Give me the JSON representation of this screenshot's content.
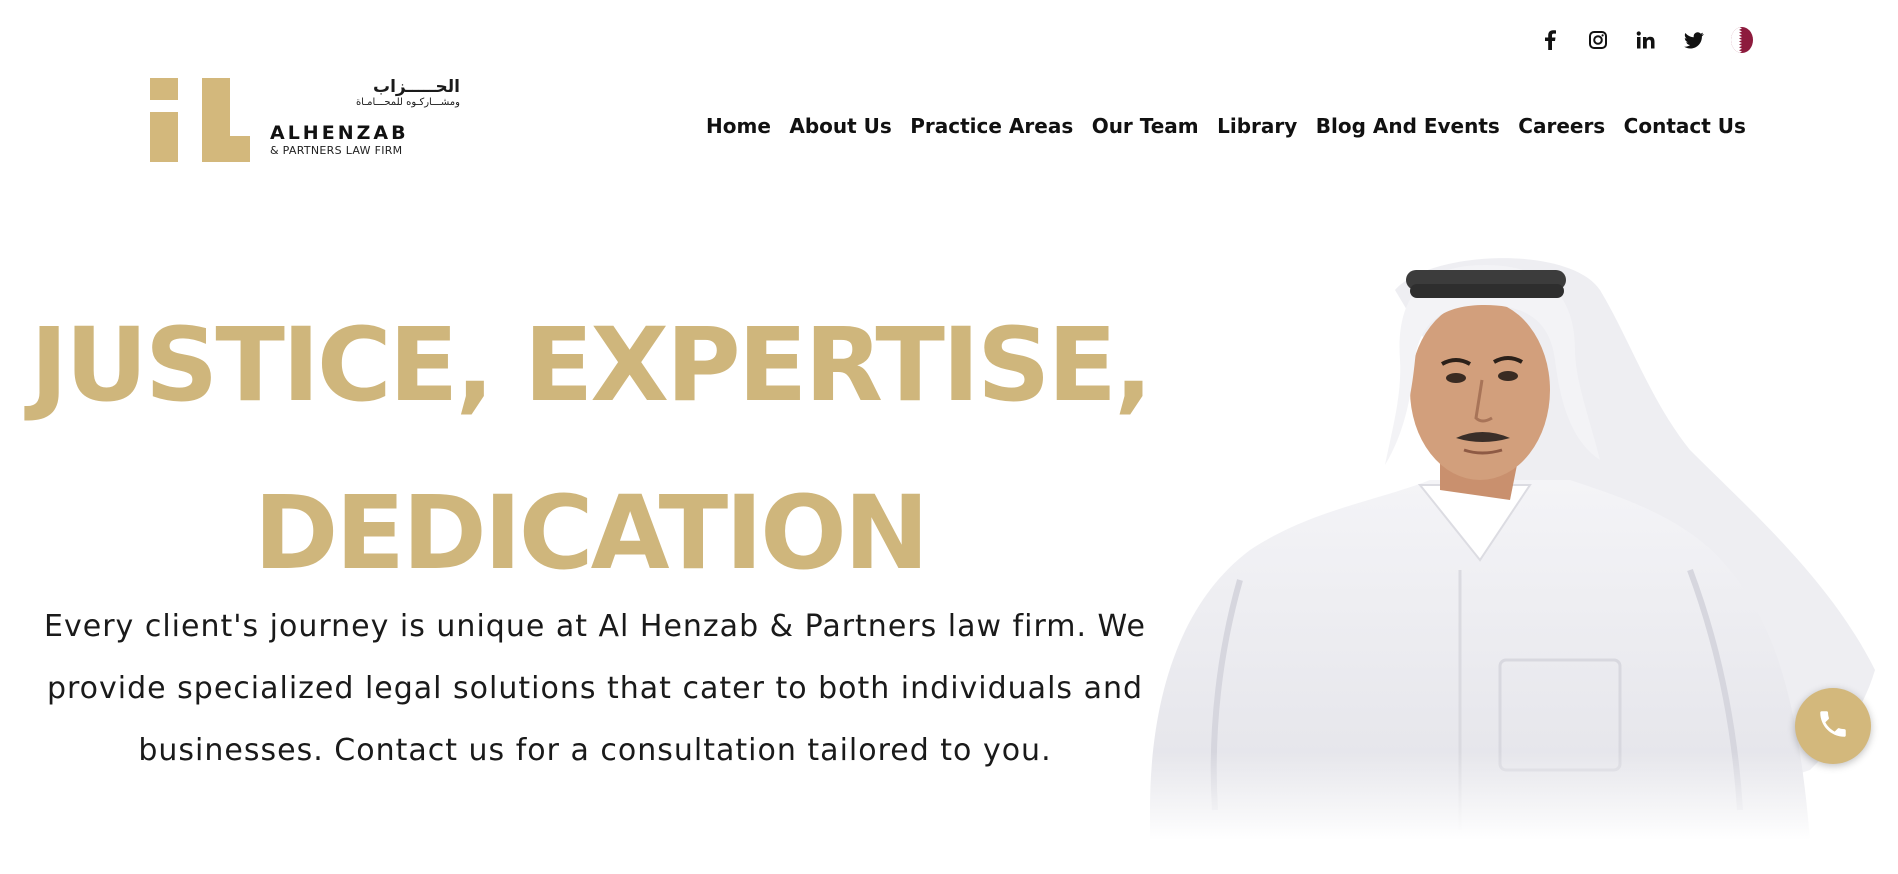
{
  "social": [
    {
      "name": "facebook",
      "icon": "facebook-icon",
      "glyph": "f"
    },
    {
      "name": "instagram",
      "icon": "instagram-icon"
    },
    {
      "name": "linkedin",
      "icon": "linkedin-icon",
      "glyph": "in"
    },
    {
      "name": "twitter",
      "icon": "twitter-icon"
    },
    {
      "name": "language",
      "icon": "qatar-flag-icon"
    }
  ],
  "logo": {
    "arabic_line1": "الحـــــزاب",
    "arabic_line2": "ومشـــاركـوه للمحـــامـاة",
    "name": "ALHENZAB",
    "subtitle": "& PARTNERS LAW FIRM",
    "color": "#d3b87c"
  },
  "nav": {
    "items": [
      {
        "label": "Home"
      },
      {
        "label": "About Us"
      },
      {
        "label": "Practice Areas"
      },
      {
        "label": "Our Team"
      },
      {
        "label": "Library"
      },
      {
        "label": "Blog And Events"
      },
      {
        "label": "Careers"
      },
      {
        "label": "Contact Us"
      }
    ]
  },
  "hero": {
    "title_line1": "JUSTICE, EXPERTISE,",
    "title_line2": "DEDICATION",
    "text_line1": "Every client's journey is unique at Al Henzab & Partners law firm. We",
    "text_line2": "provide specialized legal solutions that cater to both individuals and",
    "text_line3": "businesses. Contact us for a consultation tailored to you.",
    "accent_color": "#cfb67c"
  },
  "call_button": {
    "icon": "phone-icon",
    "color": "#d3b87c"
  }
}
